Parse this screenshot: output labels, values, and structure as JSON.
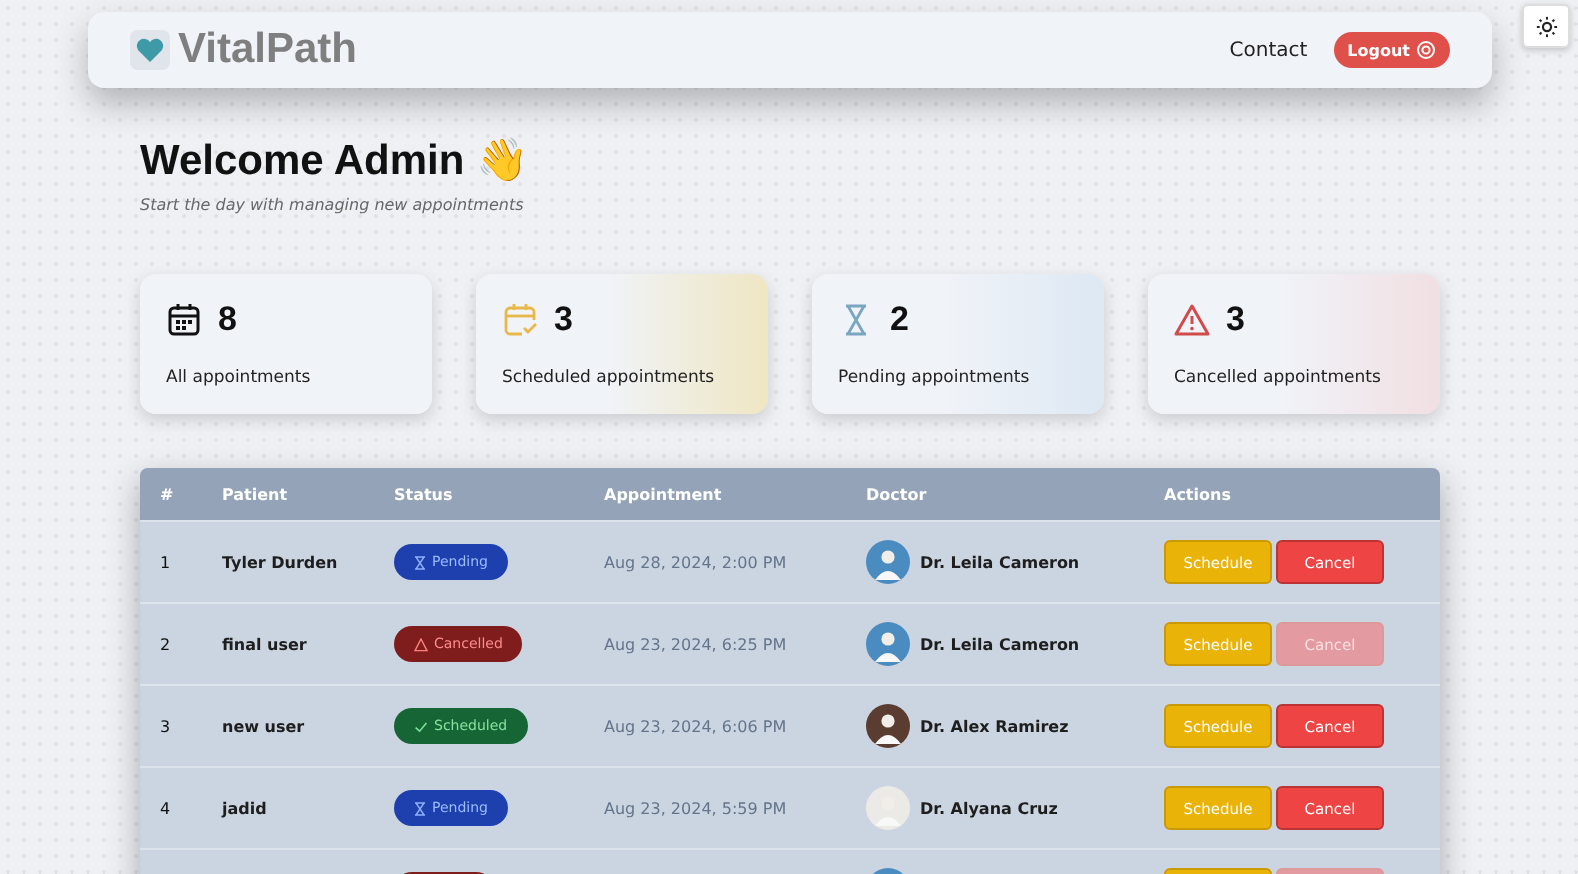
{
  "navbar": {
    "brand": "VitalPath",
    "links": [
      "Contact"
    ],
    "logout": "Logout"
  },
  "welcome": {
    "title": "Welcome Admin 👋",
    "subtitle": "Start the day with managing new appointments"
  },
  "stats": [
    {
      "kind": "all",
      "count": "8",
      "label": "All appointments"
    },
    {
      "kind": "scheduled",
      "count": "3",
      "label": "Scheduled appointments"
    },
    {
      "kind": "pending",
      "count": "2",
      "label": "Pending appointments"
    },
    {
      "kind": "cancelled",
      "count": "3",
      "label": "Cancelled appointments"
    }
  ],
  "table": {
    "columns": [
      "#",
      "Patient",
      "Status",
      "Appointment",
      "Doctor",
      "Actions"
    ],
    "rows": [
      {
        "number": "1",
        "patient": "Tyler Durden",
        "status": {
          "kind": "pending",
          "label": "Pending"
        },
        "appointment": "Aug 28, 2024, 2:00 PM",
        "doctor": "Dr. Leila Cameron",
        "schedule": "Schedule",
        "cancel": "Cancel",
        "cancel_disabled": false
      },
      {
        "number": "2",
        "patient": "final user",
        "status": {
          "kind": "cancelled",
          "label": "Cancelled"
        },
        "appointment": "Aug 23, 2024, 6:25 PM",
        "doctor": "Dr. Leila Cameron",
        "schedule": "Schedule",
        "cancel": "Cancel",
        "cancel_disabled": true
      },
      {
        "number": "3",
        "patient": "new user",
        "status": {
          "kind": "scheduled",
          "label": "Scheduled"
        },
        "appointment": "Aug 23, 2024, 6:06 PM",
        "doctor": "Dr. Alex Ramirez",
        "schedule": "Schedule",
        "cancel": "Cancel",
        "cancel_disabled": false
      },
      {
        "number": "4",
        "patient": "jadid",
        "status": {
          "kind": "pending",
          "label": "Pending"
        },
        "appointment": "Aug 23, 2024, 5:59 PM",
        "doctor": "Dr. Alyana Cruz",
        "schedule": "Schedule",
        "cancel": "Cancel",
        "cancel_disabled": false
      },
      {
        "status": {
          "kind": "cancelled"
        },
        "cancel_disabled": true
      }
    ]
  }
}
